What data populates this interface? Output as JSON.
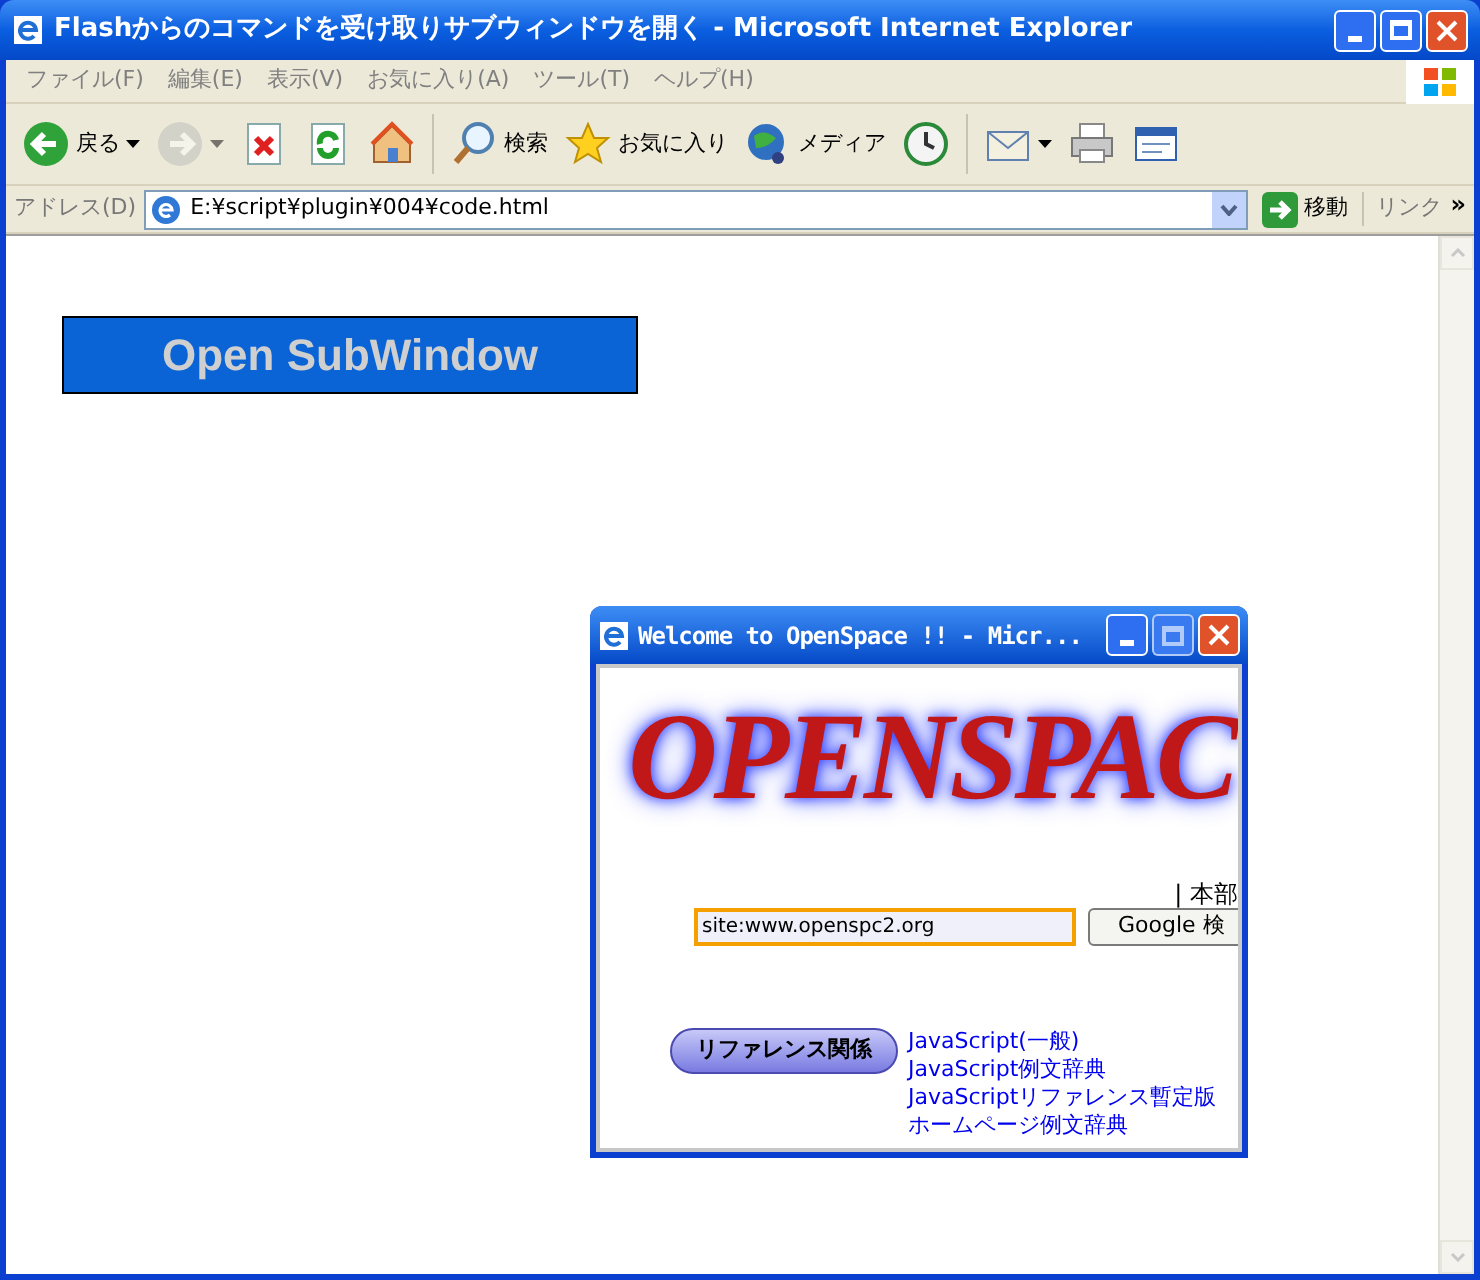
{
  "window": {
    "title": "Flashからのコマンドを受け取りサブウィンドウを開く - Microsoft Internet Explorer"
  },
  "menu": [
    "ファイル(F)",
    "編集(E)",
    "表示(V)",
    "お気に入り(A)",
    "ツール(T)",
    "ヘルプ(H)"
  ],
  "toolbar": [
    {
      "kind": "back",
      "label": "戻る",
      "dropdown": true,
      "disabled": false
    },
    {
      "kind": "forward",
      "dropdown": true,
      "disabled": true
    },
    {
      "kind": "stop",
      "disabled": false
    },
    {
      "kind": "refresh",
      "disabled": false
    },
    {
      "kind": "home",
      "disabled": false
    },
    {
      "kind": "search",
      "label": "検索",
      "disabled": false
    },
    {
      "kind": "favorites",
      "label": "お気に入り",
      "disabled": false
    },
    {
      "kind": "media",
      "label": "メディア",
      "disabled": false
    },
    {
      "kind": "history",
      "disabled": false
    },
    {
      "kind": "mail",
      "dropdown": true,
      "disabled": false
    },
    {
      "kind": "print",
      "disabled": false
    },
    {
      "kind": "edit",
      "disabled": false
    }
  ],
  "address_bar": {
    "label": "アドレス(D)",
    "value": "E:¥script¥plugin¥004¥code.html",
    "go": "移動",
    "links": "リンク",
    "more": "»"
  },
  "page": {
    "flash_button": "Open SubWindow"
  },
  "popup": {
    "title": "Welcome to OpenSpace !! - Micr...",
    "logo": "OPENSPAC",
    "nav": "| 本部",
    "search": {
      "value": "site:www.openspc2.org",
      "button": "Google 検"
    },
    "reference_button": "リファレンス関係",
    "links": [
      "JavaScript(一般)",
      "JavaScript例文辞典",
      "JavaScriptリファレンス暫定版",
      "ホームページ例文辞典"
    ]
  }
}
